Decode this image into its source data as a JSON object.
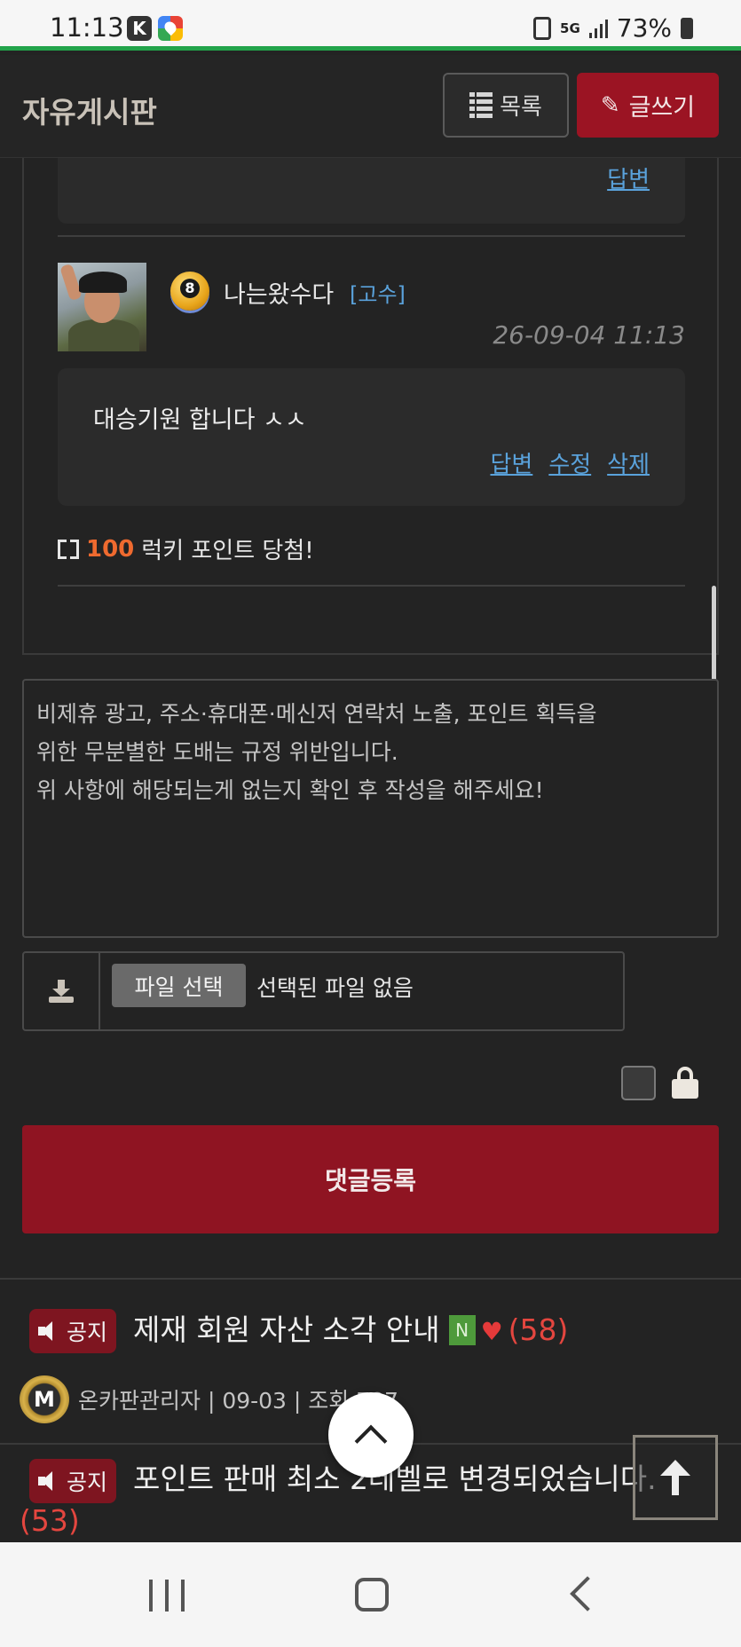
{
  "status_bar": {
    "time": "11:13",
    "app_badge": "K",
    "network": "5G",
    "battery": "73%"
  },
  "header": {
    "title": "자유게시판",
    "list_button": "목록",
    "write_button": "글쓰기"
  },
  "previous_comment": {
    "reply_link": "답변"
  },
  "comment": {
    "level": "8",
    "nickname": "나는왔수다",
    "rank": "[고수]",
    "date": "26-09-04 11:13",
    "text": "대승기원 합니다 ㅅㅅ",
    "actions": [
      "답변",
      "수정",
      "삭제"
    ],
    "lucky_points": "100",
    "lucky_text": "럭키 포인트 당첨!"
  },
  "comment_form": {
    "placeholder_lines": [
      "비제휴 광고, 주소·휴대폰·메신저 연락처 노출, 포인트 획득을",
      "위한 무분별한 도배는 규정 위반입니다.",
      "위 사항에 해당되는게 없는지 확인 후 작성을 해주세요!"
    ],
    "file_button": "파일 선택",
    "file_status": "선택된 파일 없음",
    "secret_checked": false,
    "submit_label": "댓글등록"
  },
  "notices": [
    {
      "badge": "공지",
      "title": "제재 회원 자산 소각 안내",
      "new": "N",
      "count": "(58)",
      "author_badge": "M",
      "meta": "온카판관리자 | 09-03 | 조회 787"
    },
    {
      "badge": "공지",
      "title": "포인트 판매 최소 2레벨로 변경되었습니다.",
      "count": "(53)"
    }
  ],
  "colors": {
    "accent": "#9b1423",
    "link": "#5aa2db",
    "lucky": "#ef6a2f",
    "heart": "#e53a3a"
  }
}
